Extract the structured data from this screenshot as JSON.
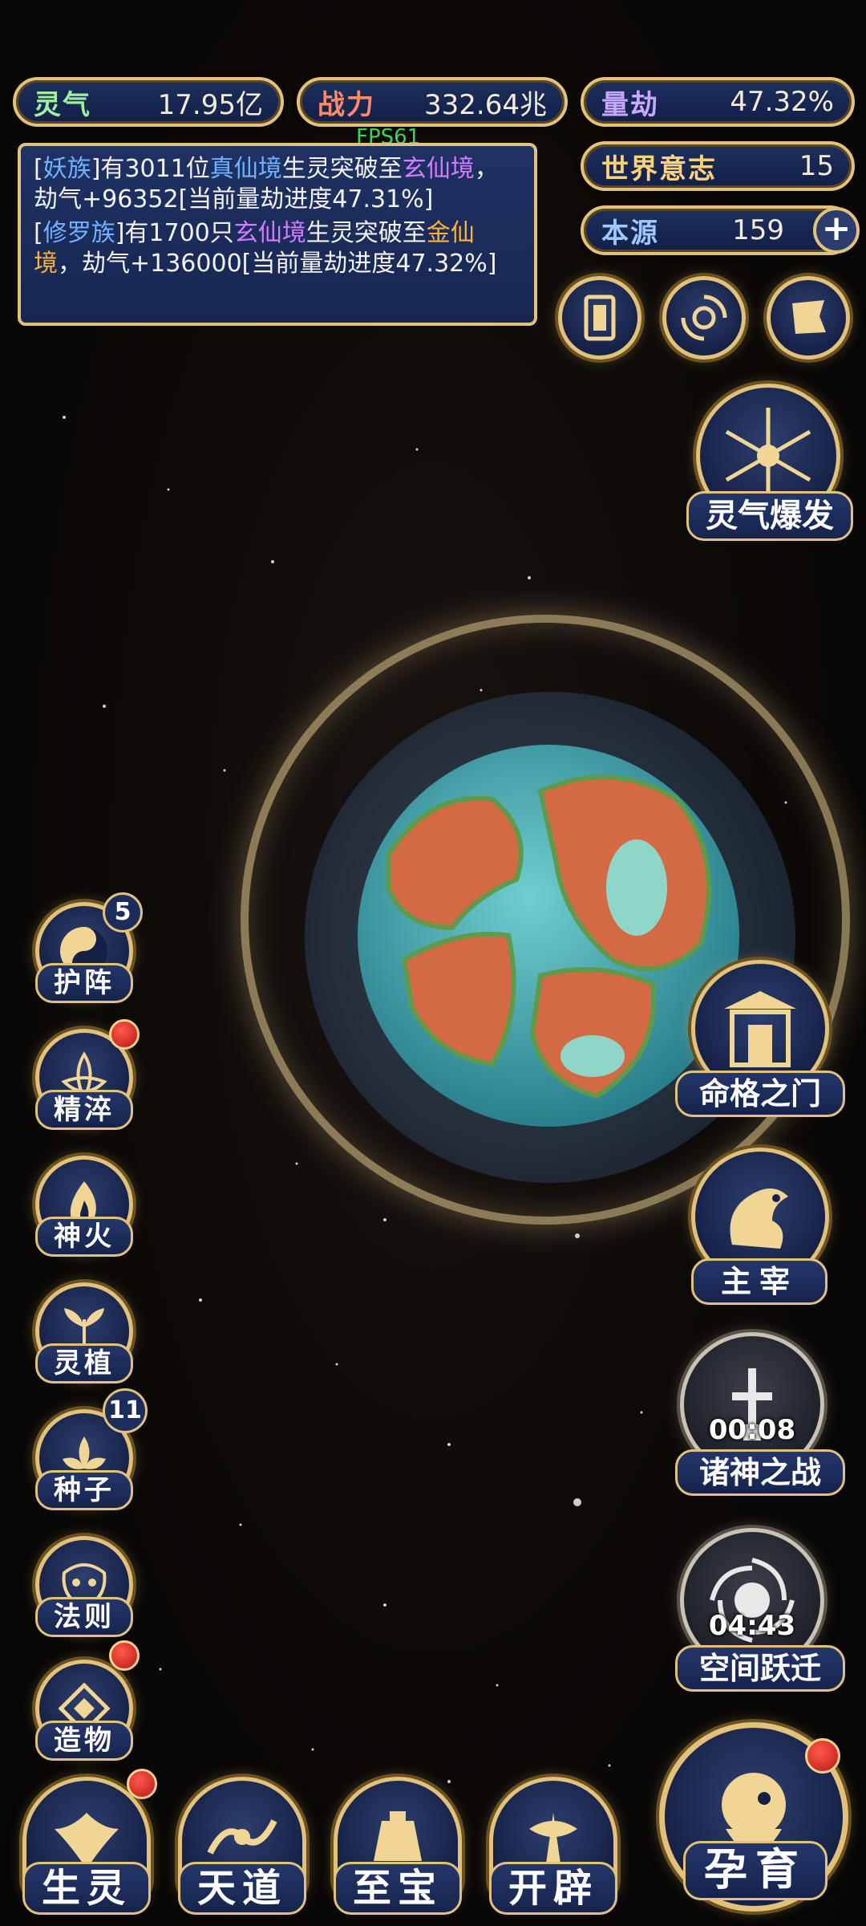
{
  "resources": {
    "lingqi": {
      "label": "灵气",
      "value": "17.95亿"
    },
    "zhanli": {
      "label": "战力",
      "value": "332.64兆"
    },
    "liangjie": {
      "label": "量劫",
      "value": "47.32%"
    },
    "world_will": {
      "label": "世界意志",
      "value": "15"
    },
    "benyuan": {
      "label": "本源",
      "value": "159"
    }
  },
  "fps": "FPS61",
  "log": {
    "msg1": {
      "p1": "[",
      "race": "妖族",
      "p2": "]有3011位",
      "realm1": "真仙境",
      "p3": "生灵突破至",
      "realm2": "玄仙境",
      "p4": "，劫气+96352[当前量劫进度47.31%]"
    },
    "msg2": {
      "p1": "[",
      "race": "修罗族",
      "p2": "]有1700只",
      "realm1": "玄仙境",
      "p3": "生灵突破至",
      "realm2": "金仙境",
      "p4": "，劫气+136000[当前量劫进度47.32%]"
    }
  },
  "right_buttons": {
    "burst": "灵气爆发",
    "fate_gate": "命格之门",
    "ruler": "主宰",
    "gods_war": "诸神之战",
    "gods_war_timer": "00:08",
    "space_jump": "空间跃迁",
    "space_jump_timer": "04:43"
  },
  "left_buttons": [
    {
      "label": "护阵",
      "badge": "5"
    },
    {
      "label": "精淬",
      "badge": ""
    },
    {
      "label": "神火",
      "badge": ""
    },
    {
      "label": "灵植",
      "badge": ""
    },
    {
      "label": "种子",
      "badge": "11"
    },
    {
      "label": "法则",
      "badge": ""
    },
    {
      "label": "造物",
      "badge": ""
    }
  ],
  "bottom_nav": [
    {
      "label": "生灵"
    },
    {
      "label": "天道"
    },
    {
      "label": "至宝"
    },
    {
      "label": "开辟"
    }
  ],
  "breed_button": "孕育",
  "colors": {
    "gold": "#e2c27a",
    "panel_blue": "#1d2f5c",
    "ocean": "#4fb3b8",
    "land": "#d46a44"
  }
}
